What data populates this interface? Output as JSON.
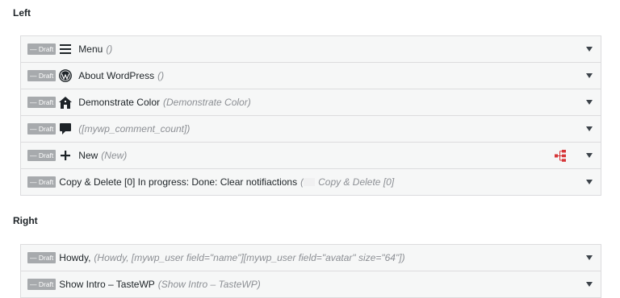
{
  "sections": {
    "left": {
      "heading": "Left",
      "items": [
        {
          "badge": "— Draft",
          "icon": "menu-icon",
          "title": "Menu",
          "sub": "()"
        },
        {
          "badge": "— Draft",
          "icon": "wordpress-icon",
          "title": "About WordPress",
          "sub": "()"
        },
        {
          "badge": "— Draft",
          "icon": "home-icon",
          "title": "Demonstrate Color",
          "sub": "(Demonstrate Color)"
        },
        {
          "badge": "— Draft",
          "icon": "comment-icon",
          "title": "",
          "sub": "([mywp_comment_count])"
        },
        {
          "badge": "— Draft",
          "icon": "plus-icon",
          "title": "New",
          "sub": "(New)"
        },
        {
          "badge": "— Draft",
          "icon": "",
          "title": "Copy & Delete [0] In progress: Done: Clear notifiactions",
          "sub_open": "(",
          "sub": "Copy & Delete [0]"
        }
      ]
    },
    "right": {
      "heading": "Right",
      "items": [
        {
          "badge": "— Draft",
          "title": "Howdy,",
          "sub": "(Howdy, [mywp_user field=\"name\"][mywp_user field=\"avatar\" size=\"64\"])"
        },
        {
          "badge": "— Draft",
          "title": "Show Intro – TasteWP",
          "sub": "(Show Intro – TasteWP)"
        }
      ]
    }
  },
  "colors": {
    "row_bg": "#f6f7f7",
    "border": "#dcdcde",
    "badge_bg": "#a7aaad",
    "sub_text": "#8c8f94",
    "sitemap_icon": "#d63638"
  }
}
